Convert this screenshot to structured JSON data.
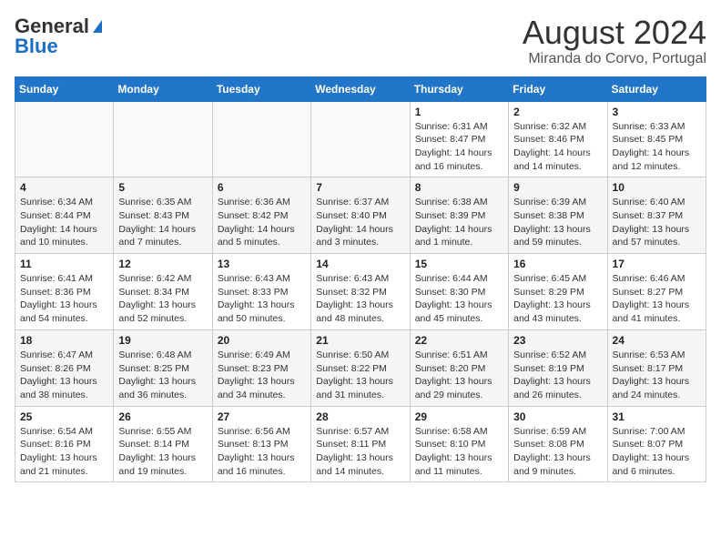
{
  "header": {
    "logo_general": "General",
    "logo_blue": "Blue",
    "month": "August 2024",
    "location": "Miranda do Corvo, Portugal"
  },
  "days_of_week": [
    "Sunday",
    "Monday",
    "Tuesday",
    "Wednesday",
    "Thursday",
    "Friday",
    "Saturday"
  ],
  "weeks": [
    [
      {
        "day": "",
        "sunrise": "",
        "sunset": "",
        "daylight": ""
      },
      {
        "day": "",
        "sunrise": "",
        "sunset": "",
        "daylight": ""
      },
      {
        "day": "",
        "sunrise": "",
        "sunset": "",
        "daylight": ""
      },
      {
        "day": "",
        "sunrise": "",
        "sunset": "",
        "daylight": ""
      },
      {
        "day": "1",
        "sunrise": "Sunrise: 6:31 AM",
        "sunset": "Sunset: 8:47 PM",
        "daylight": "Daylight: 14 hours and 16 minutes."
      },
      {
        "day": "2",
        "sunrise": "Sunrise: 6:32 AM",
        "sunset": "Sunset: 8:46 PM",
        "daylight": "Daylight: 14 hours and 14 minutes."
      },
      {
        "day": "3",
        "sunrise": "Sunrise: 6:33 AM",
        "sunset": "Sunset: 8:45 PM",
        "daylight": "Daylight: 14 hours and 12 minutes."
      }
    ],
    [
      {
        "day": "4",
        "sunrise": "Sunrise: 6:34 AM",
        "sunset": "Sunset: 8:44 PM",
        "daylight": "Daylight: 14 hours and 10 minutes."
      },
      {
        "day": "5",
        "sunrise": "Sunrise: 6:35 AM",
        "sunset": "Sunset: 8:43 PM",
        "daylight": "Daylight: 14 hours and 7 minutes."
      },
      {
        "day": "6",
        "sunrise": "Sunrise: 6:36 AM",
        "sunset": "Sunset: 8:42 PM",
        "daylight": "Daylight: 14 hours and 5 minutes."
      },
      {
        "day": "7",
        "sunrise": "Sunrise: 6:37 AM",
        "sunset": "Sunset: 8:40 PM",
        "daylight": "Daylight: 14 hours and 3 minutes."
      },
      {
        "day": "8",
        "sunrise": "Sunrise: 6:38 AM",
        "sunset": "Sunset: 8:39 PM",
        "daylight": "Daylight: 14 hours and 1 minute."
      },
      {
        "day": "9",
        "sunrise": "Sunrise: 6:39 AM",
        "sunset": "Sunset: 8:38 PM",
        "daylight": "Daylight: 13 hours and 59 minutes."
      },
      {
        "day": "10",
        "sunrise": "Sunrise: 6:40 AM",
        "sunset": "Sunset: 8:37 PM",
        "daylight": "Daylight: 13 hours and 57 minutes."
      }
    ],
    [
      {
        "day": "11",
        "sunrise": "Sunrise: 6:41 AM",
        "sunset": "Sunset: 8:36 PM",
        "daylight": "Daylight: 13 hours and 54 minutes."
      },
      {
        "day": "12",
        "sunrise": "Sunrise: 6:42 AM",
        "sunset": "Sunset: 8:34 PM",
        "daylight": "Daylight: 13 hours and 52 minutes."
      },
      {
        "day": "13",
        "sunrise": "Sunrise: 6:43 AM",
        "sunset": "Sunset: 8:33 PM",
        "daylight": "Daylight: 13 hours and 50 minutes."
      },
      {
        "day": "14",
        "sunrise": "Sunrise: 6:43 AM",
        "sunset": "Sunset: 8:32 PM",
        "daylight": "Daylight: 13 hours and 48 minutes."
      },
      {
        "day": "15",
        "sunrise": "Sunrise: 6:44 AM",
        "sunset": "Sunset: 8:30 PM",
        "daylight": "Daylight: 13 hours and 45 minutes."
      },
      {
        "day": "16",
        "sunrise": "Sunrise: 6:45 AM",
        "sunset": "Sunset: 8:29 PM",
        "daylight": "Daylight: 13 hours and 43 minutes."
      },
      {
        "day": "17",
        "sunrise": "Sunrise: 6:46 AM",
        "sunset": "Sunset: 8:27 PM",
        "daylight": "Daylight: 13 hours and 41 minutes."
      }
    ],
    [
      {
        "day": "18",
        "sunrise": "Sunrise: 6:47 AM",
        "sunset": "Sunset: 8:26 PM",
        "daylight": "Daylight: 13 hours and 38 minutes."
      },
      {
        "day": "19",
        "sunrise": "Sunrise: 6:48 AM",
        "sunset": "Sunset: 8:25 PM",
        "daylight": "Daylight: 13 hours and 36 minutes."
      },
      {
        "day": "20",
        "sunrise": "Sunrise: 6:49 AM",
        "sunset": "Sunset: 8:23 PM",
        "daylight": "Daylight: 13 hours and 34 minutes."
      },
      {
        "day": "21",
        "sunrise": "Sunrise: 6:50 AM",
        "sunset": "Sunset: 8:22 PM",
        "daylight": "Daylight: 13 hours and 31 minutes."
      },
      {
        "day": "22",
        "sunrise": "Sunrise: 6:51 AM",
        "sunset": "Sunset: 8:20 PM",
        "daylight": "Daylight: 13 hours and 29 minutes."
      },
      {
        "day": "23",
        "sunrise": "Sunrise: 6:52 AM",
        "sunset": "Sunset: 8:19 PM",
        "daylight": "Daylight: 13 hours and 26 minutes."
      },
      {
        "day": "24",
        "sunrise": "Sunrise: 6:53 AM",
        "sunset": "Sunset: 8:17 PM",
        "daylight": "Daylight: 13 hours and 24 minutes."
      }
    ],
    [
      {
        "day": "25",
        "sunrise": "Sunrise: 6:54 AM",
        "sunset": "Sunset: 8:16 PM",
        "daylight": "Daylight: 13 hours and 21 minutes."
      },
      {
        "day": "26",
        "sunrise": "Sunrise: 6:55 AM",
        "sunset": "Sunset: 8:14 PM",
        "daylight": "Daylight: 13 hours and 19 minutes."
      },
      {
        "day": "27",
        "sunrise": "Sunrise: 6:56 AM",
        "sunset": "Sunset: 8:13 PM",
        "daylight": "Daylight: 13 hours and 16 minutes."
      },
      {
        "day": "28",
        "sunrise": "Sunrise: 6:57 AM",
        "sunset": "Sunset: 8:11 PM",
        "daylight": "Daylight: 13 hours and 14 minutes."
      },
      {
        "day": "29",
        "sunrise": "Sunrise: 6:58 AM",
        "sunset": "Sunset: 8:10 PM",
        "daylight": "Daylight: 13 hours and 11 minutes."
      },
      {
        "day": "30",
        "sunrise": "Sunrise: 6:59 AM",
        "sunset": "Sunset: 8:08 PM",
        "daylight": "Daylight: 13 hours and 9 minutes."
      },
      {
        "day": "31",
        "sunrise": "Sunrise: 7:00 AM",
        "sunset": "Sunset: 8:07 PM",
        "daylight": "Daylight: 13 hours and 6 minutes."
      }
    ]
  ]
}
